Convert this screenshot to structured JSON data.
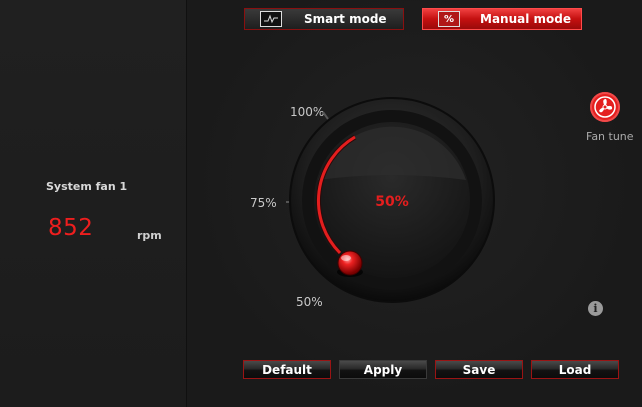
{
  "fan": {
    "name": "System fan 1",
    "speed": "852",
    "unit": "rpm"
  },
  "modes": {
    "smart_label": "Smart mode",
    "manual_label": "Manual mode",
    "manual_icon_text": "%",
    "active": "manual"
  },
  "dial": {
    "value_text": "50%",
    "value": 50,
    "min_label": "50%",
    "mid_label": "75%",
    "max_label": "100%"
  },
  "fan_tune": {
    "label": "Fan tune",
    "icon": "fan-icon"
  },
  "info": {
    "glyph": "i"
  },
  "buttons": {
    "default": "Default",
    "apply": "Apply",
    "save": "Save",
    "load": "Load"
  },
  "colors": {
    "accent": "#e41e1e",
    "background": "#1b1b1b"
  }
}
